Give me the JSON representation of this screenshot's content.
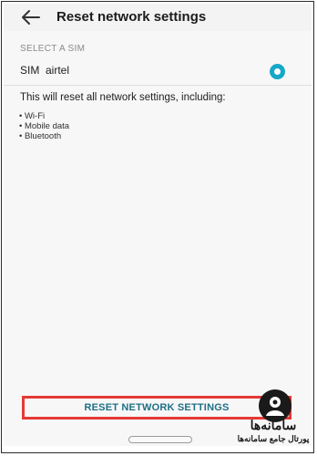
{
  "header": {
    "title": "Reset network settings",
    "back_icon": "arrow-left-icon"
  },
  "sim_section": {
    "label": "SELECT A SIM",
    "sim_name": "SIM  airtel",
    "selected": true,
    "accent_color": "#16a8c8"
  },
  "description": "This will reset all network settings, including:",
  "settings_list": [
    "Wi-Fi",
    "Mobile data",
    "Bluetooth"
  ],
  "reset_button": {
    "label": "RESET NETWORK SETTINGS",
    "highlight_color": "#e53935"
  },
  "watermark": {
    "title": "سامانه‌ها",
    "subtitle": "پورتال جامع سامانه‌ها",
    "icon": "person-icon"
  }
}
